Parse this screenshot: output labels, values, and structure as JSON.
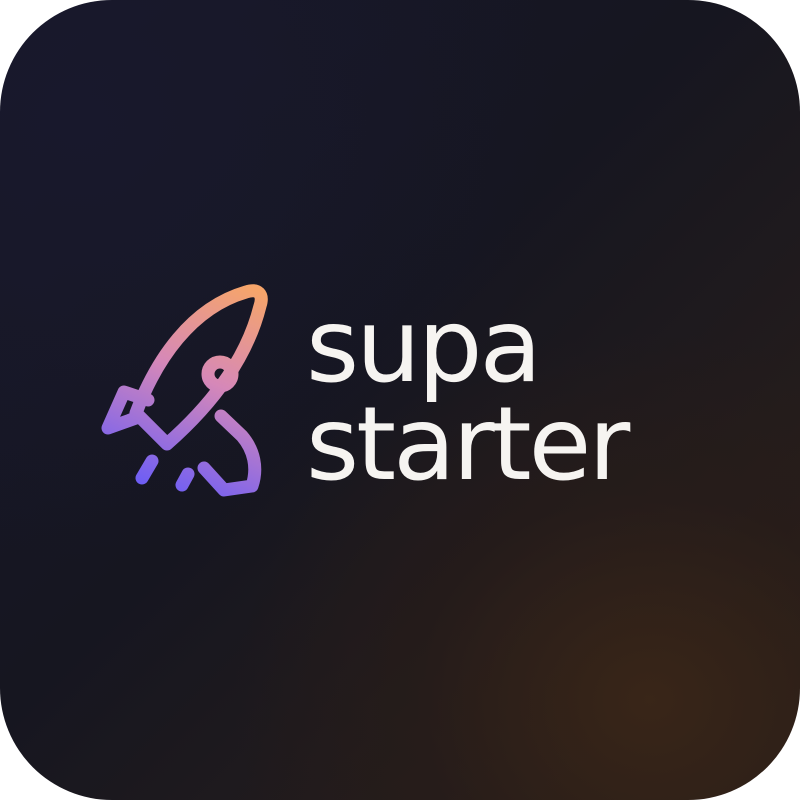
{
  "logo": {
    "icon": "rocket-icon",
    "wordmark_line_1": "supa",
    "wordmark_line_2": "starter"
  },
  "colors": {
    "background_dark": "#17182a",
    "background_warm": "#2e2118",
    "text": "#f6f4f1",
    "rocket_gradient_top": "#f4a26a",
    "rocket_gradient_mid": "#c67fd0",
    "rocket_gradient_bottom": "#6b5cf6"
  }
}
